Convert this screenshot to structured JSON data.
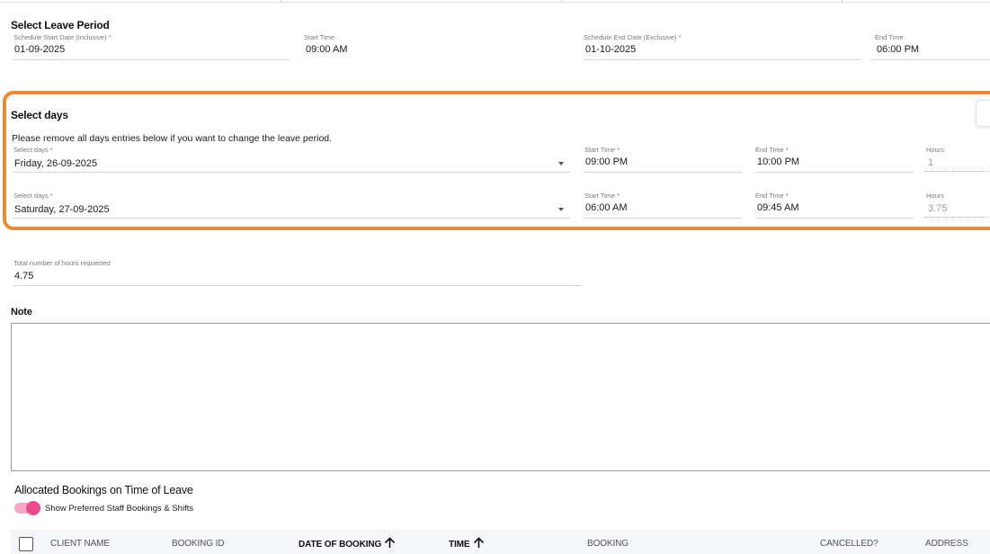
{
  "leave_period": {
    "heading": "Select Leave Period",
    "start_date": {
      "label": "Schedule Start Date (Inclusive) *",
      "value": "01-09-2025"
    },
    "start_time": {
      "label": "Start Time",
      "value": "09:00 AM"
    },
    "end_date": {
      "label": "Schedule End Date (Exclusive) *",
      "value": "01-10-2025"
    },
    "end_time": {
      "label": "End Time",
      "value": "06:00 PM"
    }
  },
  "select_days": {
    "heading": "Select days",
    "hint": "Please remove all days entries below if you want to change the leave period.",
    "rows": [
      {
        "day_label": "Select days *",
        "day_value": "Friday, 26-09-2025",
        "start_label": "Start Time *",
        "start_value": "09:00 PM",
        "end_label": "End Time *",
        "end_value": "10:00 PM",
        "hours_label": "Hours",
        "hours_value": "1"
      },
      {
        "day_label": "Select days *",
        "day_value": "Saturday, 27-09-2025",
        "start_label": "Start Time *",
        "start_value": "06:00 AM",
        "end_label": "End Time *",
        "end_value": "09:45 AM",
        "hours_label": "Hours",
        "hours_value": "3.75"
      }
    ]
  },
  "total_hours": {
    "label": "Total number of hours requested",
    "value": "4.75"
  },
  "note": {
    "heading": "Note",
    "value": ""
  },
  "bookings": {
    "heading": "Allocated Bookings on Time of Leave",
    "toggle_label": "Show Preferred Staff Bookings & Shifts",
    "toggle_on": true,
    "columns": [
      "CLIENT NAME",
      "BOOKING ID",
      "DATE OF BOOKING",
      "TIME",
      "BOOKING",
      "CANCELLED?",
      "ADDRESS"
    ]
  },
  "colors": {
    "highlight": "#ea8a35",
    "toggle": "#e84c8d",
    "toggle_track": "#f3a9c6"
  },
  "icons": {
    "dropdown": "chevron-down-icon",
    "sort": "arrow-up-icon"
  }
}
